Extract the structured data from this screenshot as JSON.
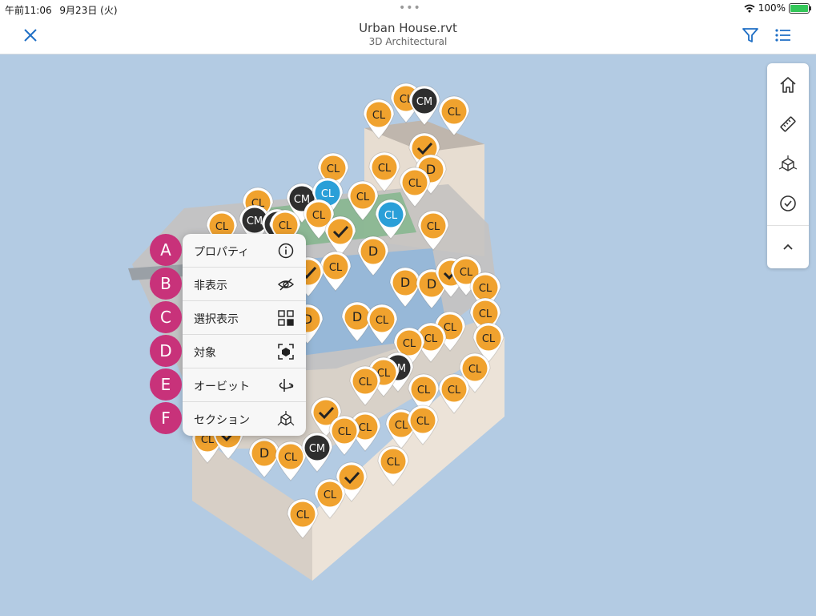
{
  "status_bar": {
    "time": "午前11:06",
    "date": "9月23日 (火)",
    "dots": "•••",
    "battery_pct": "100%"
  },
  "header": {
    "title": "Urban House.rvt",
    "subtitle": "3D Architectural"
  },
  "toolbar": {
    "items": [
      "home-icon",
      "ruler-icon",
      "model-cube-icon",
      "check-circle-icon",
      "chevron-up-icon"
    ]
  },
  "context_menu": {
    "items": [
      {
        "badge": "A",
        "label": "プロパティ",
        "icon": "info-icon"
      },
      {
        "badge": "B",
        "label": "非表示",
        "icon": "eye-off-icon"
      },
      {
        "badge": "C",
        "label": "選択表示",
        "icon": "select-grid-icon"
      },
      {
        "badge": "D",
        "label": "対象",
        "icon": "target-frame-icon"
      },
      {
        "badge": "E",
        "label": "オービット",
        "icon": "orbit-icon"
      },
      {
        "badge": "F",
        "label": "セクション",
        "icon": "section-box-icon"
      }
    ]
  },
  "pin_text": {
    "cl": "CL",
    "cm": "CM",
    "d": "D"
  },
  "colors": {
    "accent_blue": "#1f6fc5",
    "pin_orange": "#f0a22e",
    "pin_blue": "#2a9fd8",
    "pin_dark": "#2e2e2e",
    "badge_magenta": "#c8327a"
  }
}
